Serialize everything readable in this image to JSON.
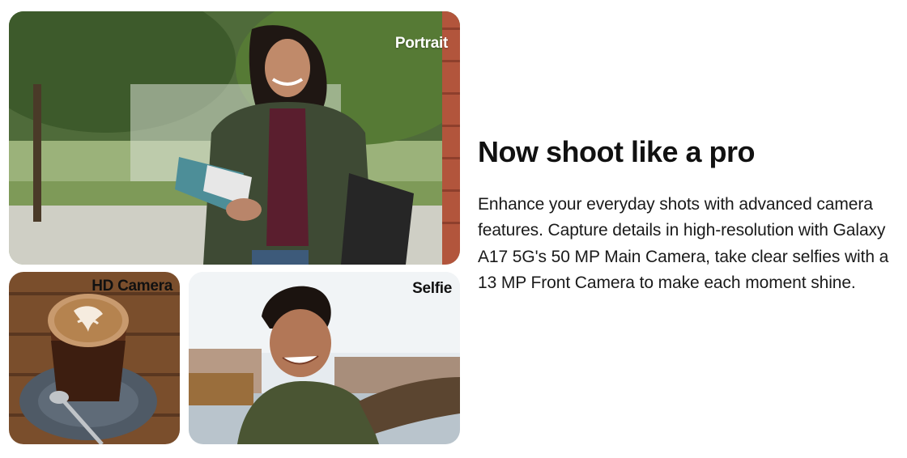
{
  "photos": {
    "portrait": {
      "label": "Portrait",
      "image": "woman-holding-notebooks-outdoors"
    },
    "hd_camera": {
      "label": "HD Camera",
      "image": "latte-art-coffee-cup"
    },
    "selfie": {
      "label": "Selfie",
      "image": "young-man-taking-selfie"
    }
  },
  "content": {
    "headline": "Now shoot like a pro",
    "description": "Enhance your everyday shots with advanced camera features. Capture details in high-resolution with Galaxy A17 5G's 50 MP Main Camera, take clear selfies with a 13 MP Front Camera to make each moment shine."
  },
  "colors": {
    "text": "#111111",
    "background": "#ffffff",
    "label_light": "#ffffff",
    "label_dark": "#111111"
  }
}
